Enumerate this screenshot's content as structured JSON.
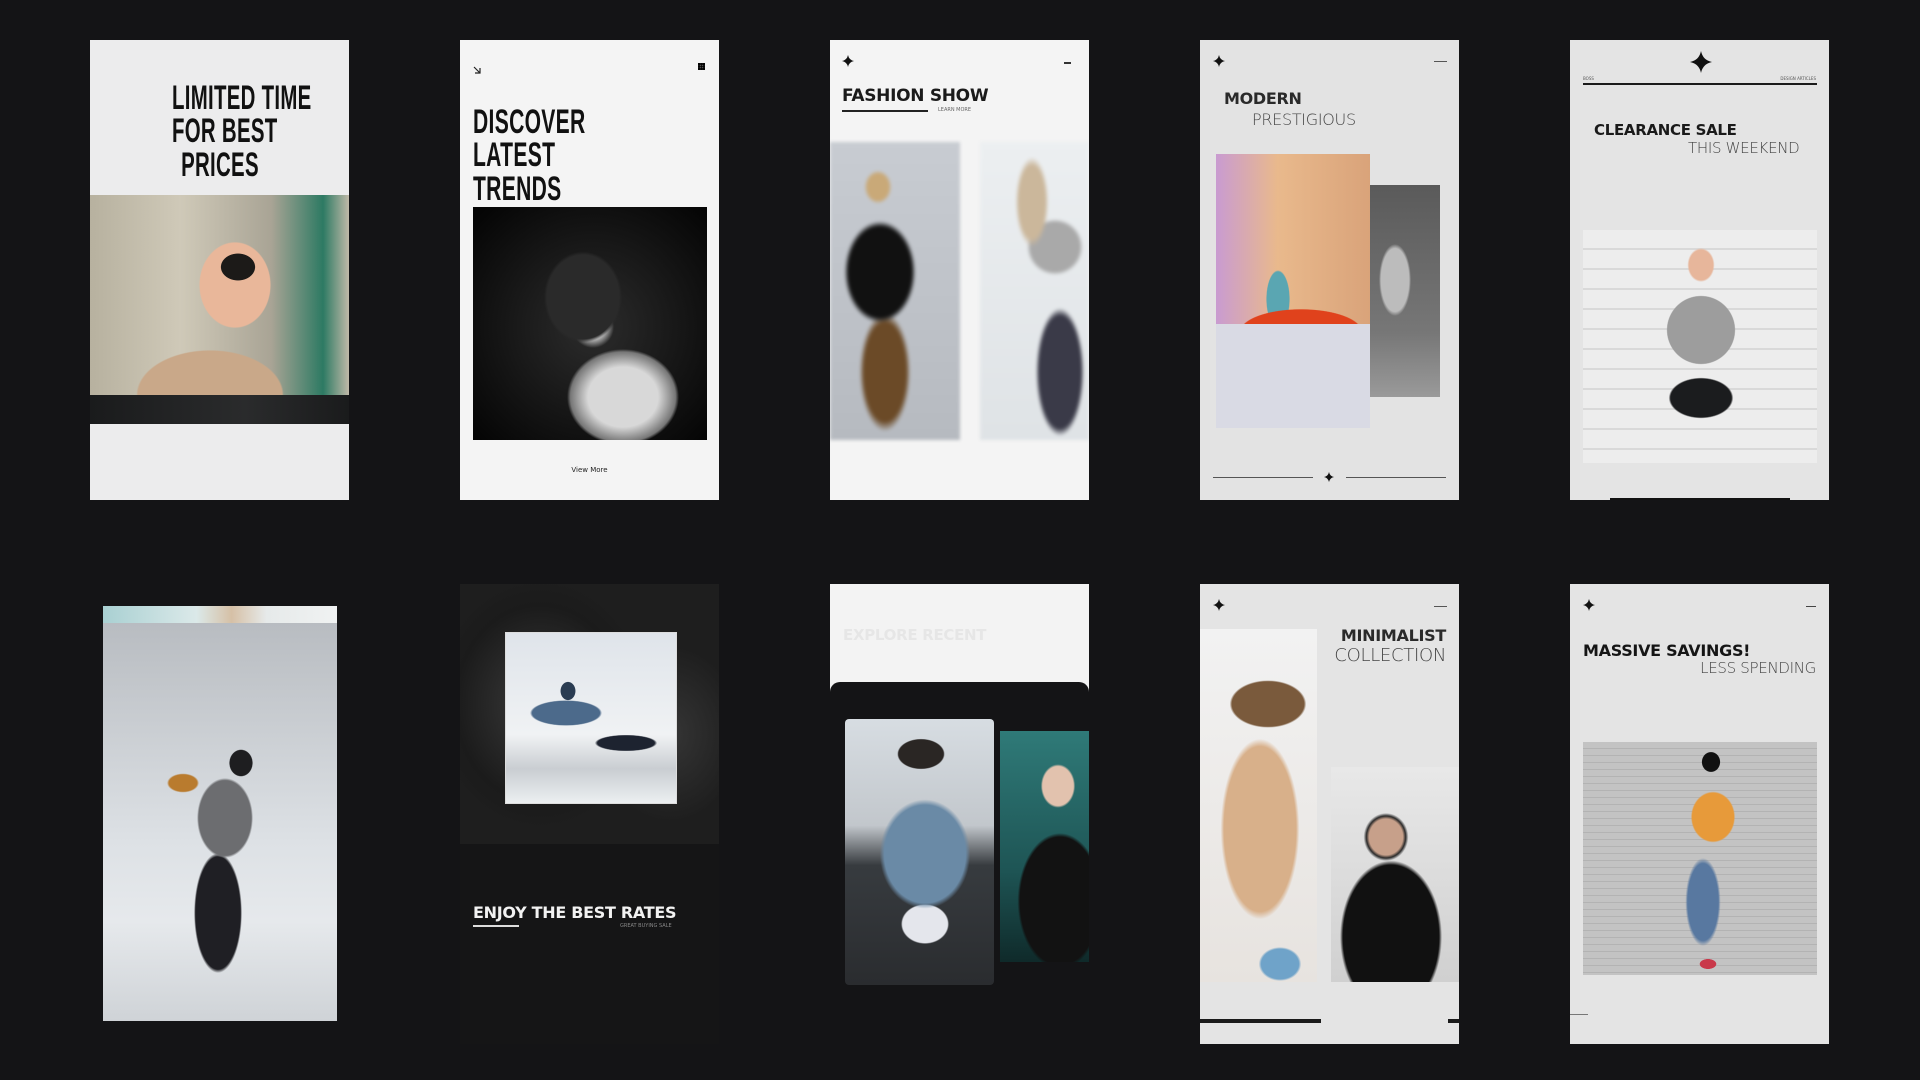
{
  "page": {
    "background": "#141416"
  },
  "cards": [
    {
      "id": "limited-time",
      "headline": [
        "LIMITED TIME",
        "FOR BEST",
        "PRICES"
      ],
      "image": "woman-sunglasses-peace-sign"
    },
    {
      "id": "discover-trends",
      "headline": [
        "DISCOVER",
        "LATEST",
        "TRENDS"
      ],
      "icons": {
        "left": "arrow-down-right-icon",
        "right": "grid-icon"
      },
      "image": "bw-woman-portrait",
      "cta": "View More"
    },
    {
      "id": "fashion-show",
      "title": "FASHION SHOW",
      "cta": "LEARN MORE",
      "icons": {
        "left": "sparkle-icon",
        "right": "menu-icon"
      },
      "images": [
        "man-black-jacket-blurred",
        "woman-grey-top-blurred"
      ]
    },
    {
      "id": "modern-prestigious",
      "title": "MODERN",
      "subtitle": "PRESTIGIOUS",
      "icons": {
        "left": "sparkle-icon",
        "right": "menu-icon",
        "footer": "sparkle-icon"
      },
      "images": [
        "woman-red-car-street",
        "bw-woman-dress"
      ]
    },
    {
      "id": "clearance-sale",
      "title": "CLEARANCE SALE",
      "subtitle": "THIS WEEKEND",
      "labels": {
        "left": "BOSS",
        "right": "DESIGN ARTICLES"
      },
      "icons": {
        "top": "sparkle-icon"
      },
      "image": "woman-usa-shirt-braids"
    },
    {
      "id": "dancer",
      "image": "man-dancing-studio"
    },
    {
      "id": "best-rates",
      "title": "ENJOY THE BEST RATES",
      "subtitle": "GREAT BUYING SALE",
      "image": "man-jumping-kick"
    },
    {
      "id": "explore-recent",
      "title": "EXPLORE RECENT",
      "images": [
        "man-denim-jacket-cap",
        "woman-black-sweater"
      ]
    },
    {
      "id": "minimalist-collection",
      "title": "MINIMALIST",
      "subtitle": "COLLECTION",
      "icons": {
        "left": "sparkle-icon",
        "right": "menu-icon"
      },
      "images": [
        "woman-hat-camel-coat",
        "woman-black-blouse"
      ]
    },
    {
      "id": "massive-savings",
      "title": "MASSIVE SAVINGS!",
      "subtitle": "LESS SPENDING",
      "icons": {
        "left": "sparkle-icon",
        "right": "menu-icon"
      },
      "image": "man-orange-shirt-shutter"
    }
  ]
}
